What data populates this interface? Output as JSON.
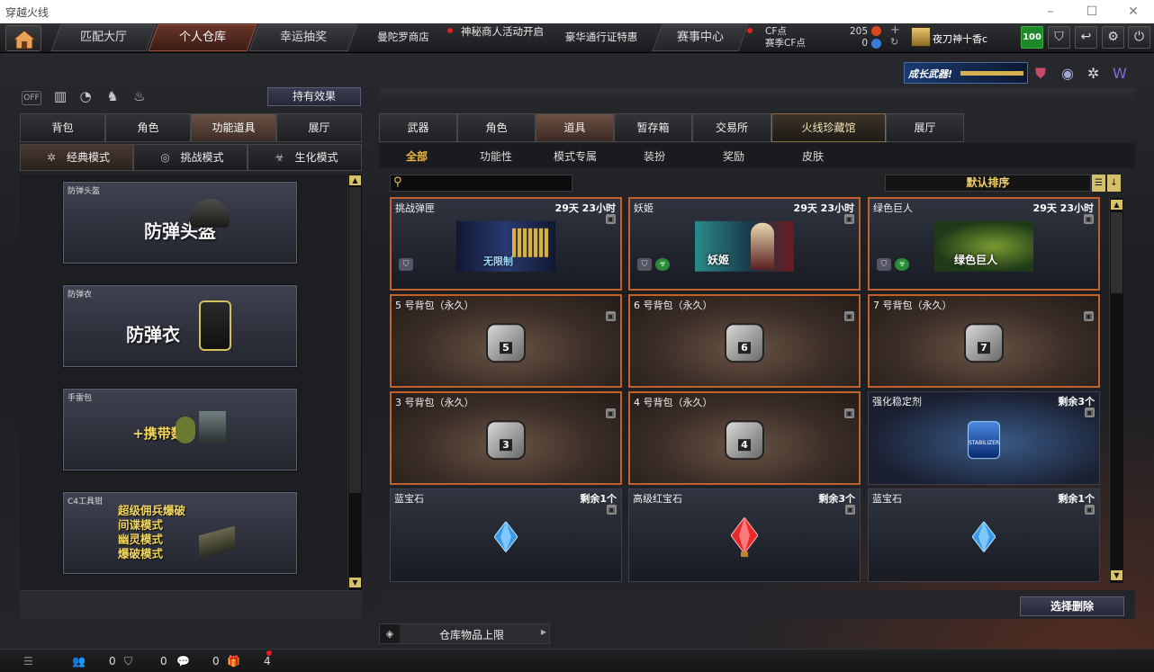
{
  "window": {
    "title": "穿越火线"
  },
  "nav": {
    "tabs": [
      {
        "label": "匹配大厅"
      },
      {
        "label": "个人仓库"
      },
      {
        "label": "幸运抽奖"
      }
    ],
    "links": [
      {
        "label": "曼陀罗商店"
      },
      {
        "label": "神秘商人活动开启"
      },
      {
        "label": "豪华通行证特惠"
      },
      {
        "label": "赛事中心"
      }
    ],
    "cf_label": "CF点",
    "cf_value": "205",
    "season_cf_label": "赛季CF点",
    "season_cf_value": "0",
    "username": "夜刀神十香c",
    "level": "100"
  },
  "banner": {
    "text": "成长武器!"
  },
  "left": {
    "effect_button": "持有效果",
    "tabs": [
      {
        "label": "背包"
      },
      {
        "label": "角色"
      },
      {
        "label": "功能道具"
      },
      {
        "label": "展厅"
      }
    ],
    "modes": [
      {
        "label": "经典模式"
      },
      {
        "label": "挑战模式"
      },
      {
        "label": "生化模式"
      }
    ],
    "items": [
      {
        "title": "防弹头盔",
        "art": "防弹头盔"
      },
      {
        "title": "防弹衣",
        "art": "防弹衣"
      },
      {
        "title": "手雷包",
        "art": "+携带数"
      },
      {
        "title": "C4工具钳",
        "art_lines": [
          "超级佣兵爆破",
          "间谍模式",
          "幽灵模式",
          "爆破模式"
        ]
      }
    ]
  },
  "right": {
    "tabs": [
      {
        "label": "武器"
      },
      {
        "label": "角色"
      },
      {
        "label": "道具"
      },
      {
        "label": "暂存箱"
      },
      {
        "label": "交易所"
      },
      {
        "label": "火线珍藏馆"
      },
      {
        "label": "展厅"
      }
    ],
    "subtabs": [
      {
        "label": "全部"
      },
      {
        "label": "功能性"
      },
      {
        "label": "模式专属"
      },
      {
        "label": "装扮"
      },
      {
        "label": "奖励"
      },
      {
        "label": "皮肤"
      }
    ],
    "sort_label": "默认排序",
    "items": [
      {
        "name": "挑战弹匣",
        "right": "29天 23小时",
        "art": "无限制"
      },
      {
        "name": "妖姬",
        "right": "29天 23小时",
        "art": "妖姬"
      },
      {
        "name": "绿色巨人",
        "right": "29天 23小时",
        "art": "绿色巨人"
      },
      {
        "name": "5 号背包（永久）",
        "right": "",
        "art": "5"
      },
      {
        "name": "6 号背包（永久）",
        "right": "",
        "art": "6"
      },
      {
        "name": "7 号背包（永久）",
        "right": "",
        "art": "7"
      },
      {
        "name": "3 号背包（永久）",
        "right": "",
        "art": "3"
      },
      {
        "name": "4 号背包（永久）",
        "right": "",
        "art": "4"
      },
      {
        "name": "强化稳定剂",
        "right": "剩余3个",
        "art": "STABILIZER"
      },
      {
        "name": "蓝宝石",
        "right": "剩余1个",
        "art": ""
      },
      {
        "name": "高级红宝石",
        "right": "剩余3个",
        "art": ""
      },
      {
        "name": "蓝宝石",
        "right": "剩余1个",
        "art": ""
      }
    ],
    "delete_button": "选择删除",
    "capacity_label": "仓库物品上限"
  },
  "statusbar": {
    "friends": "0",
    "clan": "0",
    "messages": "0",
    "gifts": "4"
  },
  "colors": {
    "accent_orange": "#c0622e",
    "gold": "#f0b840",
    "red_dot": "#e62020",
    "level_green": "#1d8a2a"
  },
  "icons": [
    "home-icon",
    "shield-icon",
    "back-icon",
    "gear-icon",
    "power-icon",
    "search-icon",
    "lock-icon",
    "gem-icon",
    "gift-icon",
    "chat-icon"
  ]
}
